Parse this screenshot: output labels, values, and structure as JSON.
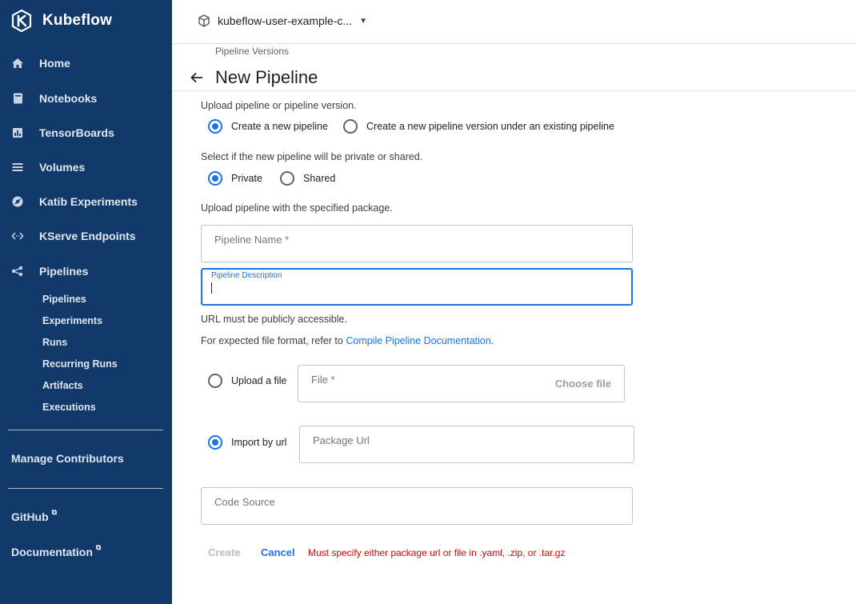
{
  "app": {
    "name": "Kubeflow"
  },
  "sidebar": {
    "items": [
      {
        "label": "Home",
        "icon": "home-icon"
      },
      {
        "label": "Notebooks",
        "icon": "notebook-icon"
      },
      {
        "label": "TensorBoards",
        "icon": "chart-icon"
      },
      {
        "label": "Volumes",
        "icon": "storage-icon"
      },
      {
        "label": "Katib Experiments",
        "icon": "katib-icon"
      },
      {
        "label": "KServe Endpoints",
        "icon": "code-arrows-icon"
      },
      {
        "label": "Pipelines",
        "icon": "pipeline-icon"
      }
    ],
    "sub_items": [
      "Pipelines",
      "Experiments",
      "Runs",
      "Recurring Runs",
      "Artifacts",
      "Executions"
    ],
    "manage_contributors": "Manage Contributors",
    "github": "GitHub",
    "documentation": "Documentation"
  },
  "topbar": {
    "namespace": "kubeflow-user-example-c..."
  },
  "page": {
    "breadcrumb": "Pipeline Versions",
    "title": "New Pipeline"
  },
  "form": {
    "upload_label": "Upload pipeline or pipeline version.",
    "create_new": "Create a new pipeline",
    "create_version": "Create a new pipeline version under an existing pipeline",
    "visibility_label": "Select if the new pipeline will be private or shared.",
    "private": "Private",
    "shared": "Shared",
    "package_label": "Upload pipeline with the specified package.",
    "name_placeholder": "Pipeline Name *",
    "description_label": "Pipeline Description",
    "url_note": "URL must be publicly accessible.",
    "format_note": "For expected file format, refer to",
    "format_link": "Compile Pipeline Documentation",
    "format_end": ".",
    "upload_file": "Upload a file",
    "file_placeholder": "File *",
    "choose_file": "Choose file",
    "import_url": "Import by url",
    "url_placeholder": "Package Url",
    "code_source_placeholder": "Code Source",
    "create_button": "Create",
    "cancel_button": "Cancel",
    "error": "Must specify either package url or file in .yaml, .zip, or .tar.gz"
  },
  "colors": {
    "sidebar_bg": "#113a6b",
    "accent": "#1a73e8",
    "error": "#e00000"
  }
}
